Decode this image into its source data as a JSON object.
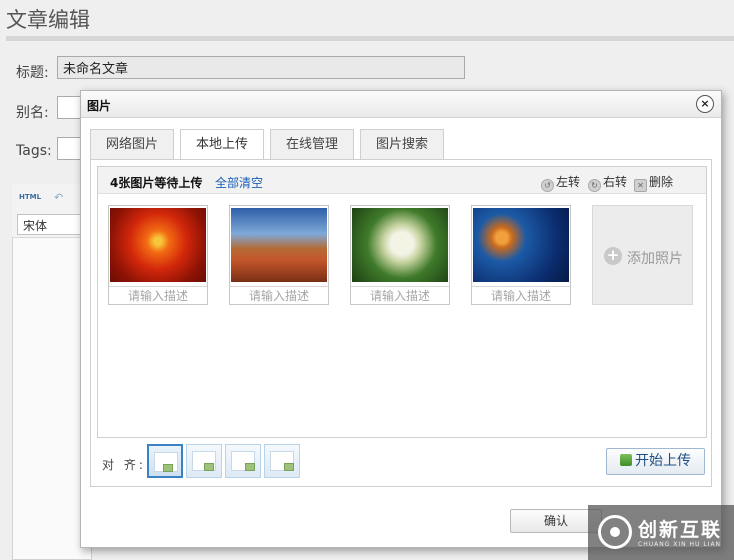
{
  "page": {
    "title": "文章编辑",
    "title_label": "标题:",
    "title_value": "未命名文章",
    "alias_label": "别名:",
    "tags_label": "Tags:"
  },
  "editor": {
    "html_button": "HTML",
    "font_value": "宋体"
  },
  "dialog": {
    "title": "图片",
    "close_symbol": "×",
    "tabs": [
      {
        "label": "网络图片",
        "active": false
      },
      {
        "label": "本地上传",
        "active": true
      },
      {
        "label": "在线管理",
        "active": false
      },
      {
        "label": "图片搜索",
        "active": false
      }
    ],
    "upload": {
      "waiting_text": "4张图片等待上传",
      "clear_all": "全部清空",
      "rotate_left": "左转",
      "rotate_right": "右转",
      "delete": "删除",
      "photos": [
        {
          "thumb": "red-flower-photo",
          "desc_placeholder": "请输入描述"
        },
        {
          "thumb": "desert-photo",
          "desc_placeholder": "请输入描述"
        },
        {
          "thumb": "hydrangea-photo",
          "desc_placeholder": "请输入描述"
        },
        {
          "thumb": "jellyfish-photo",
          "desc_placeholder": "请输入描述"
        }
      ],
      "add_photo": "添加照片",
      "add_symbol": "+"
    },
    "align_label": "对 齐:",
    "start_upload": "开始上传",
    "confirm": "确认"
  },
  "watermark": {
    "name": "创新互联",
    "pinyin": "CHUANG XIN HU LIAN"
  },
  "colors": {
    "link": "#1a5fb4",
    "selected_align_border": "#3b82c4"
  }
}
